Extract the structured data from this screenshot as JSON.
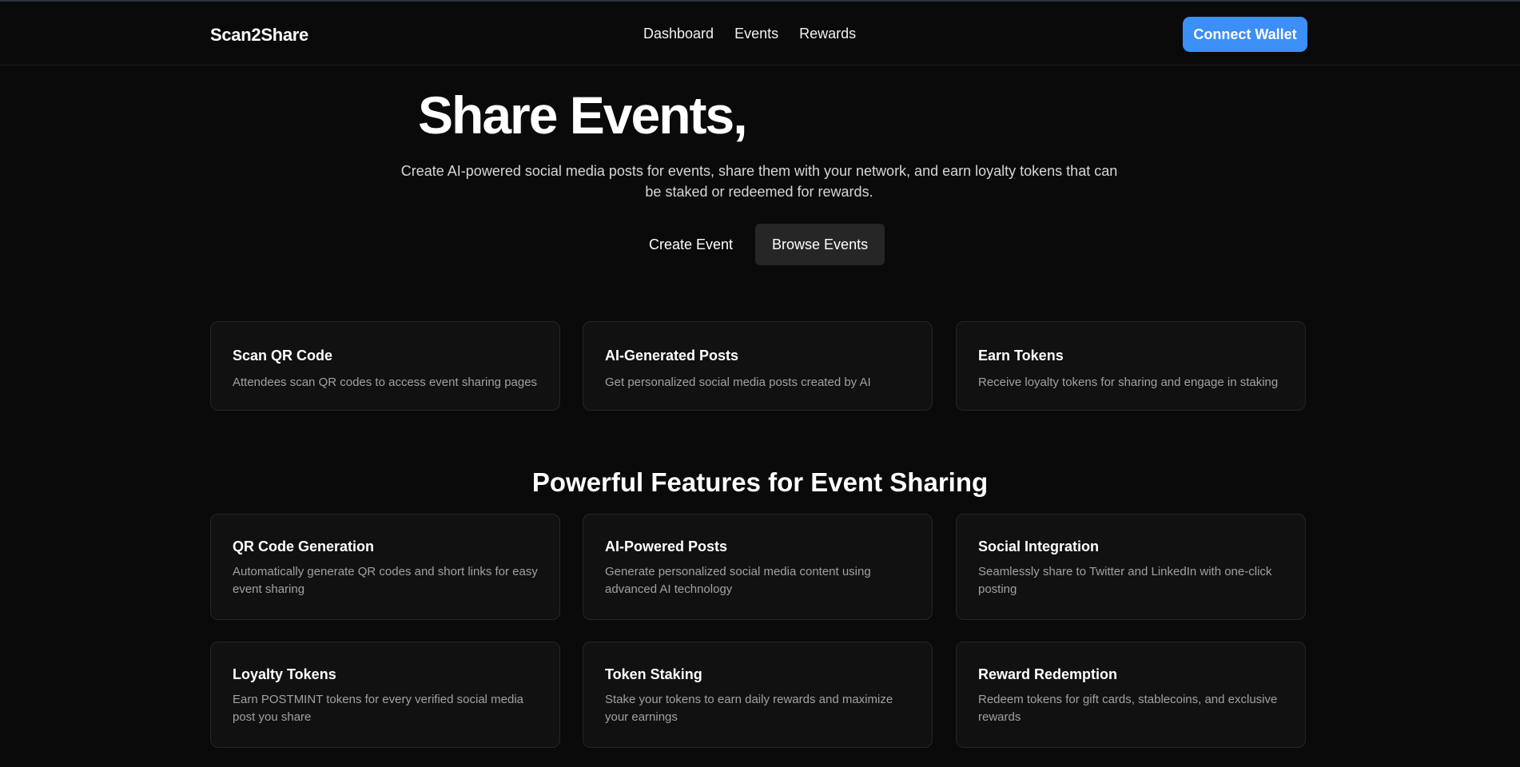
{
  "nav": {
    "brand": "Scan2Share",
    "links": [
      "Dashboard",
      "Events",
      "Rewards"
    ],
    "connect_label": "Connect Wallet",
    "accent_color": "#3b8ff6"
  },
  "hero": {
    "title": "Share Events,",
    "subtitle": "Create AI-powered social media posts for events, share them with your network, and earn loyalty tokens that can be staked or redeemed for rewards.",
    "create_label": "Create Event",
    "browse_label": "Browse Events"
  },
  "steps": [
    {
      "title": "Scan QR Code",
      "desc": "Attendees scan QR codes to access event sharing pages"
    },
    {
      "title": "AI-Generated Posts",
      "desc": "Get personalized social media posts created by AI"
    },
    {
      "title": "Earn Tokens",
      "desc": "Receive loyalty tokens for sharing and engage in staking"
    }
  ],
  "features": {
    "heading": "Powerful Features for Event Sharing",
    "items": [
      {
        "title": "QR Code Generation",
        "desc": "Automatically generate QR codes and short links for easy event sharing"
      },
      {
        "title": "AI-Powered Posts",
        "desc": "Generate personalized social media content using advanced AI technology"
      },
      {
        "title": "Social Integration",
        "desc": "Seamlessly share to Twitter and LinkedIn with one-click posting"
      },
      {
        "title": "Loyalty Tokens",
        "desc": "Earn POSTMINT tokens for every verified social media post you share"
      },
      {
        "title": "Token Staking",
        "desc": "Stake your tokens to earn daily rewards and maximize your earnings"
      },
      {
        "title": "Reward Redemption",
        "desc": "Redeem tokens for gift cards, stablecoins, and exclusive rewards"
      }
    ]
  }
}
